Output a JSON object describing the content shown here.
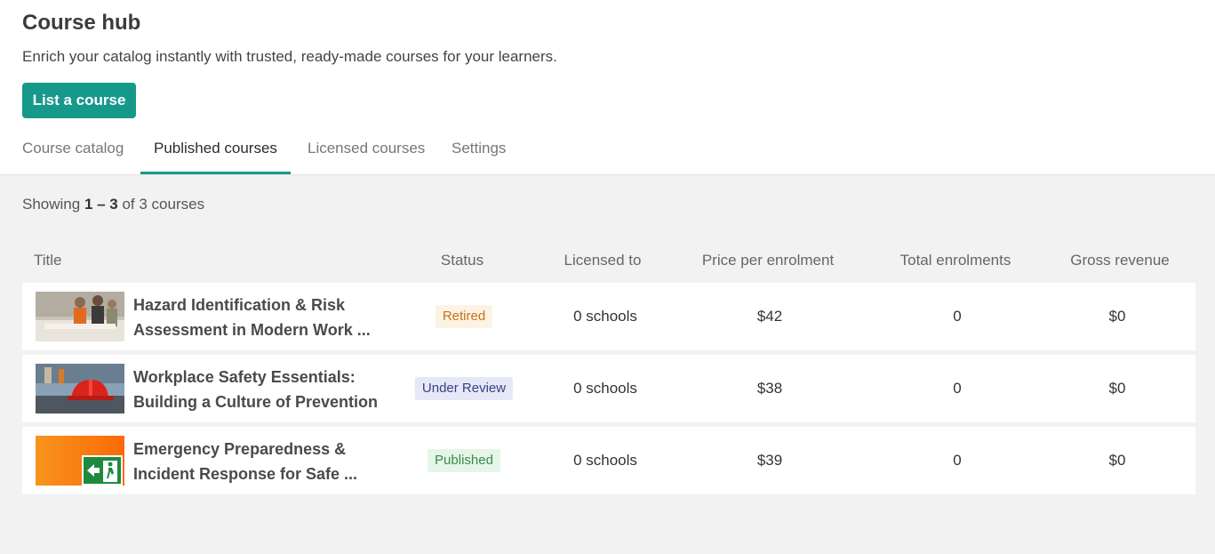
{
  "page": {
    "title": "Course hub",
    "subtitle": "Enrich your catalog instantly with trusted, ready-made courses for your learners.",
    "primary_button": "List a course"
  },
  "tabs": [
    {
      "label": "Course catalog",
      "active": false
    },
    {
      "label": "Published courses",
      "active": true
    },
    {
      "label": "Licensed courses",
      "active": false
    },
    {
      "label": "Settings",
      "active": false
    }
  ],
  "summary": {
    "prefix": "Showing ",
    "range": "1 – 3",
    "suffix": " of 3 courses"
  },
  "table": {
    "headers": {
      "title": "Title",
      "status": "Status",
      "licensed_to": "Licensed to",
      "price": "Price per enrolment",
      "enrolments": "Total enrolments",
      "revenue": "Gross revenue"
    },
    "rows": [
      {
        "title": "Hazard Identification & Risk Assessment in Modern Work ...",
        "status": "Retired",
        "status_colors": {
          "bg": "#fdf3e3",
          "fg": "#c9711a"
        },
        "licensed_to": "0 schools",
        "price": "$42",
        "enrolments": "0",
        "revenue": "$0",
        "thumb_icon": "workers-photo"
      },
      {
        "title": "Workplace Safety Essentials: Building a Culture of Prevention",
        "status": "Under Review",
        "status_colors": {
          "bg": "#e6e8f7",
          "fg": "#3a3f86"
        },
        "licensed_to": "0 schools",
        "price": "$38",
        "enrolments": "0",
        "revenue": "$0",
        "thumb_icon": "hardhat-photo"
      },
      {
        "title": "Emergency Preparedness & Incident Response for Safe ...",
        "status": "Published",
        "status_colors": {
          "bg": "#e5f5e8",
          "fg": "#3a8a4a"
        },
        "licensed_to": "0 schools",
        "price": "$39",
        "enrolments": "0",
        "revenue": "$0",
        "thumb_icon": "emergency-exit-sign"
      }
    ]
  },
  "colors": {
    "accent": "#16998a",
    "background": "#f2f2f2"
  }
}
